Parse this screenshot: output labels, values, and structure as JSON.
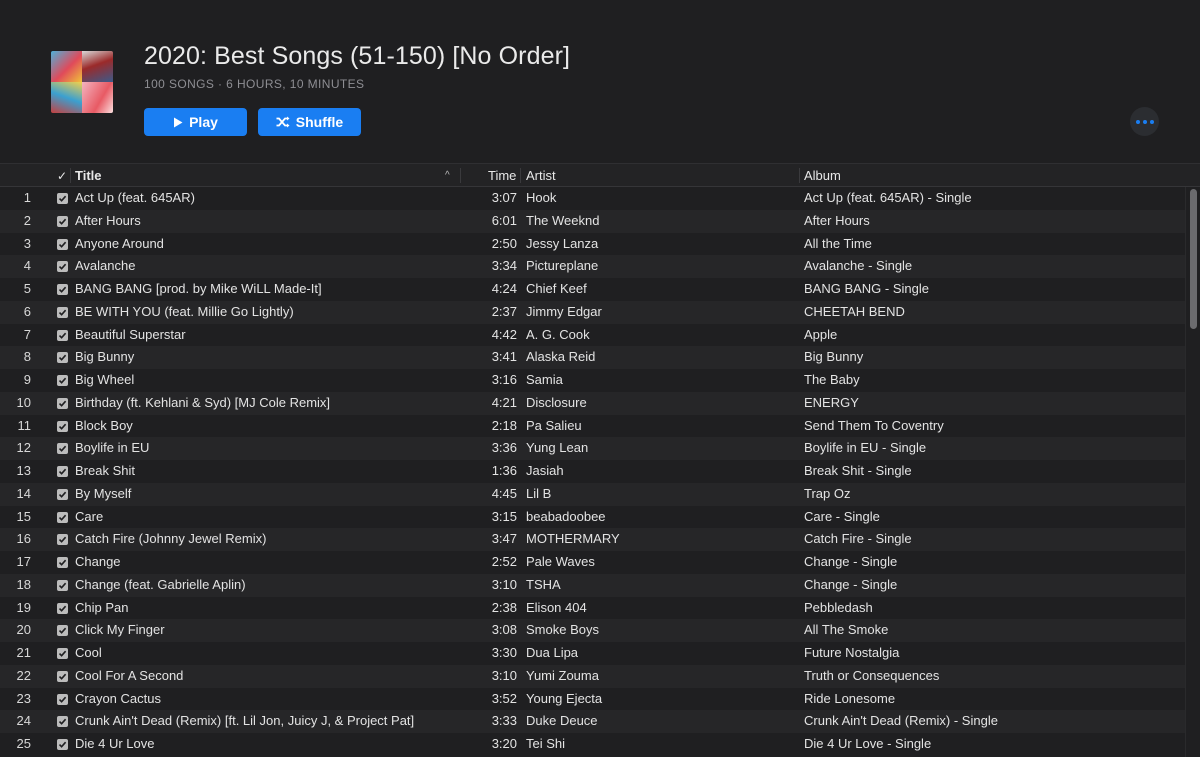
{
  "playlist": {
    "title": "2020: Best Songs (51-150) [No Order]",
    "meta": "100 SONGS · 6 HOURS, 10 MINUTES",
    "play_label": "Play",
    "shuffle_label": "Shuffle"
  },
  "columns": {
    "check": "✓",
    "title": "Title",
    "time": "Time",
    "artist": "Artist",
    "album": "Album",
    "sort_indicator": "^"
  },
  "colors": {
    "accent": "#1a7ef2",
    "background": "#1f1f21",
    "row_alt": "#262628"
  },
  "icons": [
    "play-icon",
    "shuffle-icon",
    "more-icon",
    "checkbox-icon",
    "sort-ascending-icon"
  ],
  "tracks": [
    {
      "num": "1",
      "title": "Act Up (feat. 645AR)",
      "time": "3:07",
      "artist": "Hook",
      "album": "Act Up (feat. 645AR) - Single"
    },
    {
      "num": "2",
      "title": "After Hours",
      "time": "6:01",
      "artist": "The Weeknd",
      "album": "After Hours"
    },
    {
      "num": "3",
      "title": "Anyone Around",
      "time": "2:50",
      "artist": "Jessy Lanza",
      "album": "All the Time"
    },
    {
      "num": "4",
      "title": "Avalanche",
      "time": "3:34",
      "artist": "Pictureplane",
      "album": "Avalanche - Single"
    },
    {
      "num": "5",
      "title": "BANG BANG [prod. by Mike WiLL Made-It]",
      "time": "4:24",
      "artist": "Chief Keef",
      "album": "BANG BANG - Single"
    },
    {
      "num": "6",
      "title": "BE WITH YOU (feat. Millie Go Lightly)",
      "time": "2:37",
      "artist": "Jimmy Edgar",
      "album": "CHEETAH BEND"
    },
    {
      "num": "7",
      "title": "Beautiful Superstar",
      "time": "4:42",
      "artist": "A. G. Cook",
      "album": "Apple"
    },
    {
      "num": "8",
      "title": "Big Bunny",
      "time": "3:41",
      "artist": "Alaska Reid",
      "album": "Big Bunny"
    },
    {
      "num": "9",
      "title": "Big Wheel",
      "time": "3:16",
      "artist": "Samia",
      "album": "The Baby"
    },
    {
      "num": "10",
      "title": "Birthday (ft. Kehlani & Syd) [MJ Cole Remix]",
      "time": "4:21",
      "artist": "Disclosure",
      "album": "ENERGY"
    },
    {
      "num": "11",
      "title": "Block Boy",
      "time": "2:18",
      "artist": "Pa Salieu",
      "album": "Send Them To Coventry"
    },
    {
      "num": "12",
      "title": "Boylife in EU",
      "time": "3:36",
      "artist": "Yung Lean",
      "album": "Boylife in EU - Single"
    },
    {
      "num": "13",
      "title": "Break Shit",
      "time": "1:36",
      "artist": "Jasiah",
      "album": "Break Shit - Single"
    },
    {
      "num": "14",
      "title": "By Myself",
      "time": "4:45",
      "artist": "Lil B",
      "album": "Trap Oz"
    },
    {
      "num": "15",
      "title": "Care",
      "time": "3:15",
      "artist": "beabadoobee",
      "album": "Care - Single"
    },
    {
      "num": "16",
      "title": "Catch Fire (Johnny Jewel Remix)",
      "time": "3:47",
      "artist": "MOTHERMARY",
      "album": "Catch Fire - Single"
    },
    {
      "num": "17",
      "title": "Change",
      "time": "2:52",
      "artist": "Pale Waves",
      "album": "Change - Single"
    },
    {
      "num": "18",
      "title": "Change (feat. Gabrielle Aplin)",
      "time": "3:10",
      "artist": "TSHA",
      "album": "Change - Single"
    },
    {
      "num": "19",
      "title": "Chip Pan",
      "time": "2:38",
      "artist": "Elison 404",
      "album": "Pebbledash"
    },
    {
      "num": "20",
      "title": "Click My Finger",
      "time": "3:08",
      "artist": "Smoke Boys",
      "album": "All The Smoke"
    },
    {
      "num": "21",
      "title": "Cool",
      "time": "3:30",
      "artist": "Dua Lipa",
      "album": "Future Nostalgia"
    },
    {
      "num": "22",
      "title": "Cool For A Second",
      "time": "3:10",
      "artist": "Yumi Zouma",
      "album": "Truth or Consequences"
    },
    {
      "num": "23",
      "title": "Crayon Cactus",
      "time": "3:52",
      "artist": "Young Ejecta",
      "album": "Ride Lonesome"
    },
    {
      "num": "24",
      "title": "Crunk Ain't Dead (Remix) [ft. Lil Jon, Juicy J, & Project Pat]",
      "time": "3:33",
      "artist": "Duke Deuce",
      "album": "Crunk Ain't Dead (Remix) - Single"
    },
    {
      "num": "25",
      "title": "Die 4 Ur Love",
      "time": "3:20",
      "artist": "Tei Shi",
      "album": "Die 4 Ur Love - Single"
    }
  ]
}
